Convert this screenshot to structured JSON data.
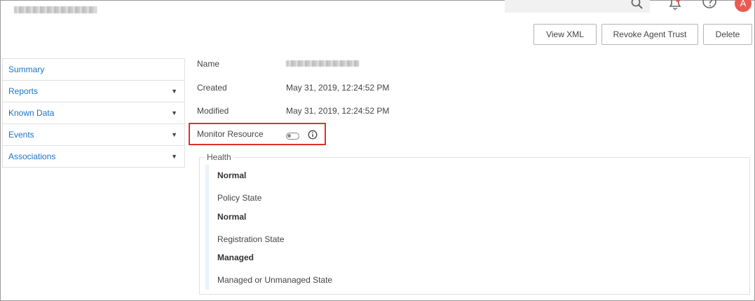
{
  "header": {
    "notifications_icon": "bell-alert-icon",
    "help_icon": "help-circle-icon",
    "search_icon": "search-icon",
    "avatar_initial": "A",
    "avatar_color": "#e85b54"
  },
  "toolbar": {
    "view_xml": "View XML",
    "revoke_agent_trust": "Revoke Agent Trust",
    "delete": "Delete"
  },
  "sidebar": {
    "items": [
      {
        "label": "Summary",
        "has_caret": false
      },
      {
        "label": "Reports",
        "has_caret": true
      },
      {
        "label": "Known Data",
        "has_caret": true
      },
      {
        "label": "Events",
        "has_caret": true
      },
      {
        "label": "Associations",
        "has_caret": true
      }
    ],
    "caret_glyph": "▼"
  },
  "details": {
    "name_label": "Name",
    "created_label": "Created",
    "created_value": "May 31, 2019, 12:24:52 PM",
    "modified_label": "Modified",
    "modified_value": "May 31, 2019, 12:24:52 PM",
    "monitor_label": "Monitor Resource",
    "monitor_enabled": false
  },
  "health": {
    "legend": "Health",
    "rows": [
      {
        "value": "Normal"
      },
      {
        "label": "Policy State"
      },
      {
        "value": "Normal"
      },
      {
        "label": "Registration State"
      },
      {
        "value": "Managed"
      },
      {
        "label": "Managed or Unmanaged State"
      }
    ]
  },
  "colors": {
    "link": "#1a73c8",
    "highlight_border": "#d8342c"
  }
}
